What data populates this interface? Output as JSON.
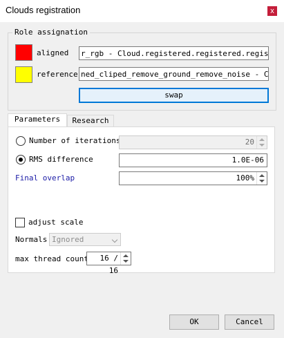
{
  "window": {
    "title": "Clouds registration",
    "close_glyph": "x"
  },
  "role_assignation": {
    "title": "Role assignation",
    "aligned": {
      "label": "aligned",
      "color": "#ff0000",
      "value": "r_rgb - Cloud.registered.registered.registered"
    },
    "reference": {
      "label": "reference",
      "color": "#ffff00",
      "value": "ned_cliped_remove_ground_remove_noise - Cloud"
    },
    "swap_label": "swap"
  },
  "tabs": [
    {
      "label": "Parameters",
      "active": true
    },
    {
      "label": "Research",
      "active": false
    }
  ],
  "parameters": {
    "iterations": {
      "label": "Number of iterations",
      "value": "20",
      "selected": false
    },
    "rms": {
      "label": "RMS difference",
      "value": "1.0E-06",
      "selected": true
    },
    "final_overlap": {
      "label": "Final overlap",
      "value": "100%",
      "color": "#1a1aa6"
    },
    "adjust_scale": {
      "label": "adjust scale",
      "checked": false
    },
    "normals": {
      "label": "Normals",
      "value": "Ignored"
    },
    "threads": {
      "label": "max thread count",
      "value": "16 / 16"
    }
  },
  "buttons": {
    "ok": "OK",
    "cancel": "Cancel"
  }
}
